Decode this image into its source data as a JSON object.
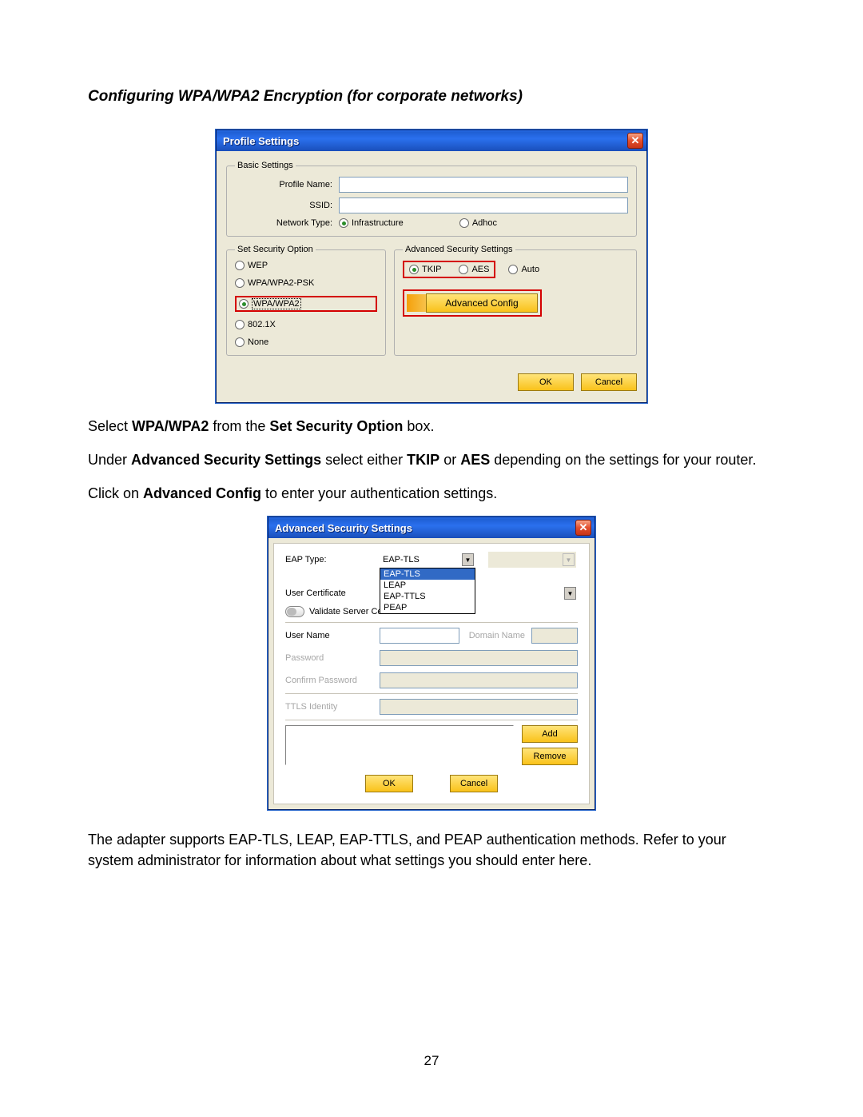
{
  "doc": {
    "section_title": "Configuring WPA/WPA2 Encryption (for corporate networks)",
    "p1_pre": "Select ",
    "p1_bold1": "WPA/WPA2",
    "p1_mid": " from the ",
    "p1_bold2": "Set Security Option",
    "p1_post": " box.",
    "p2_pre": "Under ",
    "p2_b1": "Advanced Security Settings",
    "p2_mid1": " select either ",
    "p2_b2": "TKIP",
    "p2_mid2": " or ",
    "p2_b3": "AES",
    "p2_post": " depending on the settings for your router.",
    "p3_pre": "Click on ",
    "p3_b1": "Advanced Config",
    "p3_post": " to enter your authentication settings.",
    "p4": "The adapter supports EAP-TLS, LEAP, EAP-TTLS, and PEAP authentication methods. Refer to your system administrator for information about what settings you should enter here.",
    "page_number": "27"
  },
  "dlg1": {
    "title": "Profile Settings",
    "basic_legend": "Basic Settings",
    "profile_name_lbl": "Profile Name:",
    "ssid_lbl": "SSID:",
    "network_type_lbl": "Network Type:",
    "nt_infra": "Infrastructure",
    "nt_adhoc": "Adhoc",
    "sec_legend": "Set Security Option",
    "sec": {
      "wep": "WEP",
      "wpapsk": "WPA/WPA2-PSK",
      "wpa": "WPA/WPA2",
      "dot1x": "802.1X",
      "none": "None"
    },
    "adv_legend": "Advanced Security Settings",
    "enc": {
      "tkip": "TKIP",
      "aes": "AES",
      "auto": "Auto"
    },
    "adv_btn": "Advanced Config",
    "ok": "OK",
    "cancel": "Cancel"
  },
  "dlg2": {
    "title": "Advanced Security Settings",
    "eap_type_lbl": "EAP Type:",
    "eap_selected": "EAP-TLS",
    "eap_options": [
      "EAP-TLS",
      "LEAP",
      "EAP-TTLS",
      "PEAP"
    ],
    "user_cert_lbl": "User Certificate",
    "validate_lbl": "Validate Server Cer",
    "user_name_lbl": "User Name",
    "domain_name_lbl": "Domain Name",
    "password_lbl": "Password",
    "confirm_pw_lbl": "Confirm Password",
    "ttls_lbl": "TTLS Identity",
    "add": "Add",
    "remove": "Remove",
    "ok": "OK",
    "cancel": "Cancel"
  }
}
